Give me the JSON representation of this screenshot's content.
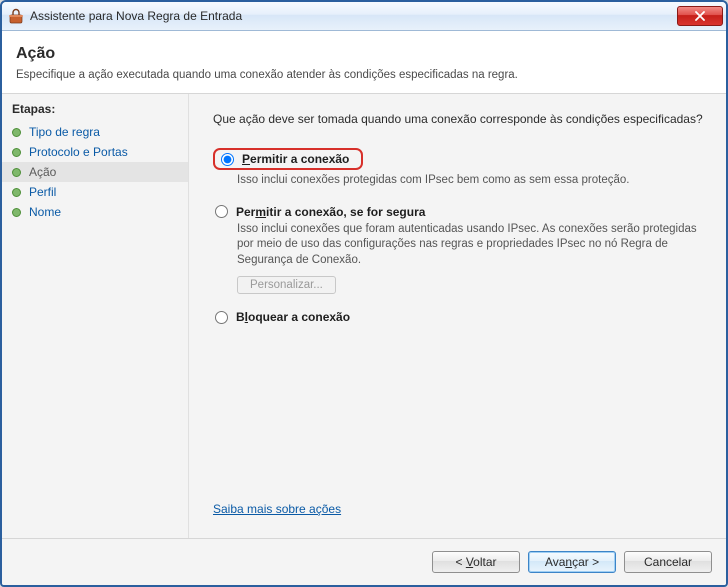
{
  "window": {
    "title": "Assistente para Nova Regra de Entrada"
  },
  "header": {
    "title": "Ação",
    "subtitle": "Especifique a ação executada quando uma conexão atender às condições especificadas na regra."
  },
  "sidebar": {
    "title": "Etapas:",
    "items": [
      {
        "label": "Tipo de regra",
        "current": false
      },
      {
        "label": "Protocolo e Portas",
        "current": false
      },
      {
        "label": "Ação",
        "current": true
      },
      {
        "label": "Perfil",
        "current": false
      },
      {
        "label": "Nome",
        "current": false
      }
    ]
  },
  "main": {
    "question": "Que ação deve ser tomada quando uma conexão corresponde às condições especificadas?",
    "options": [
      {
        "id": "allow",
        "title_before": "",
        "title_u": "P",
        "title_after": "ermitir a conexão",
        "desc": "Isso inclui conexões protegidas com IPsec bem como as sem essa proteção.",
        "selected": true,
        "highlighted": true
      },
      {
        "id": "allow-secure",
        "title_before": "Per",
        "title_u": "m",
        "title_after": "itir a conexão, se for segura",
        "desc": "Isso inclui conexões que foram autenticadas usando IPsec. As conexões serão protegidas por meio de uso das configurações nas regras e propriedades IPsec no nó Regra de Segurança de Conexão.",
        "selected": false,
        "customize_label": "Personalizar..."
      },
      {
        "id": "block",
        "title_before": "B",
        "title_u": "l",
        "title_after": "oquear a conexão",
        "desc": "",
        "selected": false
      }
    ],
    "learn_more": "Saiba mais sobre ações"
  },
  "footer": {
    "back_before": "< ",
    "back_u": "V",
    "back_after": "oltar",
    "next_before": "Ava",
    "next_u": "n",
    "next_after": "çar >",
    "cancel": "Cancelar"
  }
}
